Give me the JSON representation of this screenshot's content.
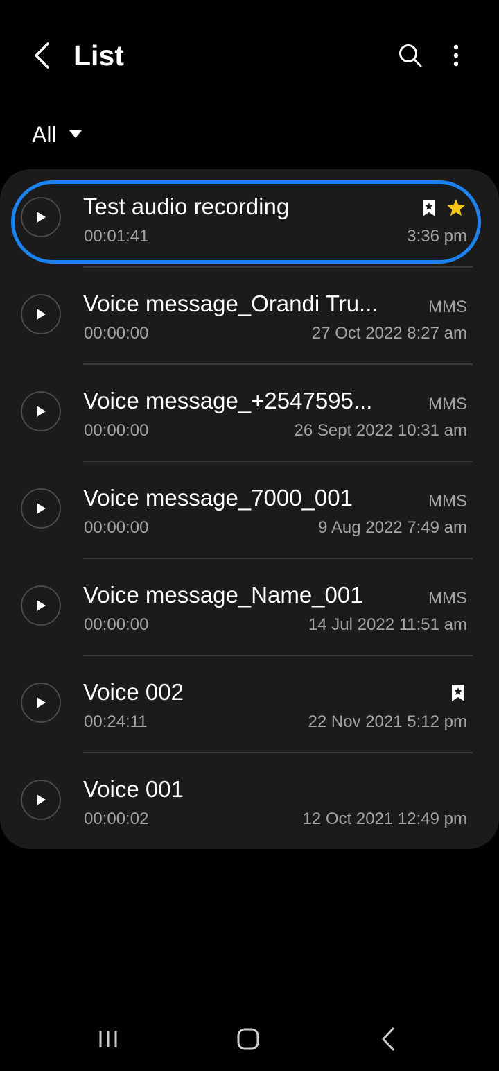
{
  "header": {
    "title": "List"
  },
  "filter": {
    "label": "All"
  },
  "recordings": [
    {
      "title": "Test audio recording",
      "duration": "00:01:41",
      "date": "3:36 pm",
      "tag": ""
    },
    {
      "title": "Voice message_Orandi Tru...",
      "duration": "00:00:00",
      "date": "27 Oct 2022 8:27 am",
      "tag": "MMS"
    },
    {
      "title": "Voice message_+2547595...",
      "duration": "00:00:00",
      "date": "26 Sept 2022 10:31 am",
      "tag": "MMS"
    },
    {
      "title": "Voice message_7000_001",
      "duration": "00:00:00",
      "date": "9 Aug 2022 7:49 am",
      "tag": "MMS"
    },
    {
      "title": "Voice message_Name_001",
      "duration": "00:00:00",
      "date": "14 Jul 2022 11:51 am",
      "tag": "MMS"
    },
    {
      "title": "Voice 002",
      "duration": "00:24:11",
      "date": "22 Nov 2021 5:12 pm",
      "tag": ""
    },
    {
      "title": "Voice 001",
      "duration": "00:00:02",
      "date": "12 Oct 2021 12:49 pm",
      "tag": ""
    }
  ],
  "colors": {
    "selection": "#1a83f0",
    "star": "#f5c518",
    "secondary_text": "#a3a3a3",
    "card": "#1b1b1b"
  }
}
